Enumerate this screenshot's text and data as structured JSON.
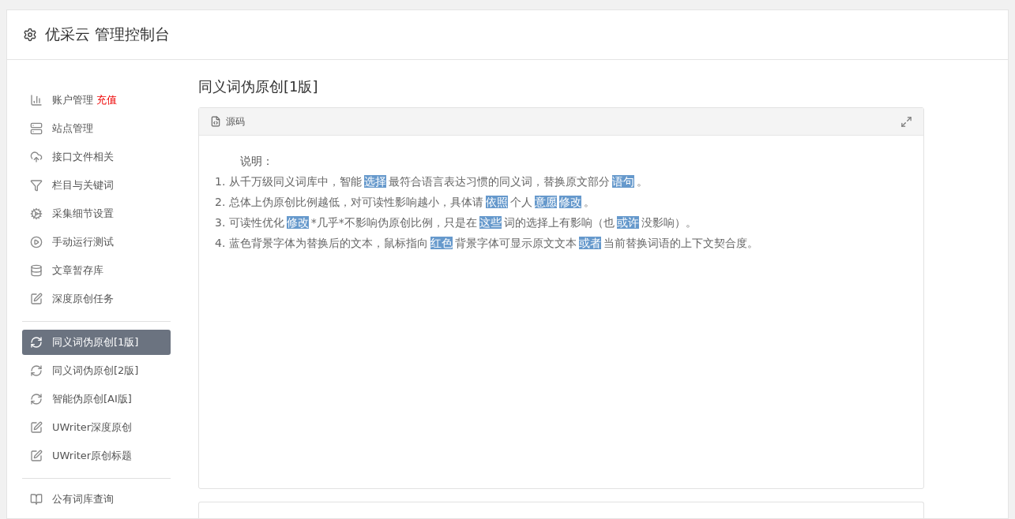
{
  "header": {
    "title": "优采云 管理控制台"
  },
  "sidebar": {
    "groups": [
      {
        "items": [
          {
            "kind": "chart",
            "label": "账户管理",
            "badge": "充值",
            "selected": false
          },
          {
            "kind": "server",
            "label": "站点管理",
            "selected": false
          },
          {
            "kind": "cloud",
            "label": "接口文件相关",
            "selected": false
          },
          {
            "kind": "filter",
            "label": "栏目与关键词",
            "selected": false
          },
          {
            "kind": "gears",
            "label": "采集细节设置",
            "selected": false
          },
          {
            "kind": "play",
            "label": "手动运行测试",
            "selected": false
          },
          {
            "kind": "database",
            "label": "文章暂存库",
            "selected": false
          },
          {
            "kind": "edit",
            "label": "深度原创任务",
            "selected": false
          }
        ]
      },
      {
        "items": [
          {
            "kind": "refresh",
            "label": "同义词伪原创[1版]",
            "selected": true
          },
          {
            "kind": "refresh",
            "label": "同义词伪原创[2版]",
            "selected": false
          },
          {
            "kind": "refresh",
            "label": "智能伪原创[AI版]",
            "selected": false
          },
          {
            "kind": "edit",
            "label": "UWriter深度原创",
            "selected": false
          },
          {
            "kind": "edit",
            "label": "UWriter原创标题",
            "selected": false
          }
        ]
      },
      {
        "items": [
          {
            "kind": "book",
            "label": "公有词库查询",
            "selected": false
          }
        ]
      }
    ]
  },
  "main": {
    "title": "同义词伪原创[1版]",
    "panel": {
      "title": "源码",
      "heading": "说明：",
      "lines": [
        [
          {
            "text": "1. 从千万级同义词库中，智能",
            "highlight": false
          },
          {
            "text": "选择",
            "highlight": true
          },
          {
            "text": "最符合语言表达习惯的同义词，替换原文部分",
            "highlight": false
          },
          {
            "text": "语句",
            "highlight": true
          },
          {
            "text": "。",
            "highlight": false
          }
        ],
        [
          {
            "text": "2. 总体上伪原创比例越低，对可读性影响越小，具体请",
            "highlight": false
          },
          {
            "text": "依照",
            "highlight": true
          },
          {
            "text": "个人",
            "highlight": false
          },
          {
            "text": "意愿",
            "highlight": true
          },
          {
            "text": "修改",
            "highlight": true
          },
          {
            "text": "。",
            "highlight": false
          }
        ],
        [
          {
            "text": "3. 可读性优化",
            "highlight": false
          },
          {
            "text": "修改",
            "highlight": true
          },
          {
            "text": "*几乎*不影响伪原创比例，只是在",
            "highlight": false
          },
          {
            "text": "这些",
            "highlight": true
          },
          {
            "text": "词的选择上有影响（也",
            "highlight": false
          },
          {
            "text": "或许",
            "highlight": true
          },
          {
            "text": "没影响）。",
            "highlight": false
          }
        ],
        [
          {
            "text": "4. 蓝色背景字体为替换后的文本，鼠标指向",
            "highlight": false
          },
          {
            "text": "红色",
            "highlight": true
          },
          {
            "text": "背景字体可显示原文文本",
            "highlight": false
          },
          {
            "text": "或者",
            "highlight": true
          },
          {
            "text": "当前替换词语的上下文契合度。",
            "highlight": false
          }
        ]
      ]
    }
  }
}
